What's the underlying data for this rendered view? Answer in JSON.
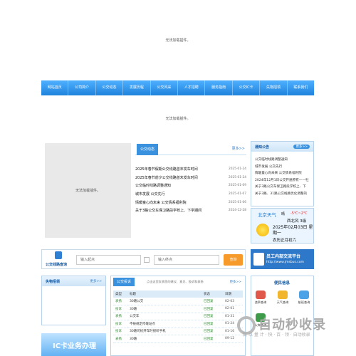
{
  "plugin": {
    "msg": "无法加载插件。"
  },
  "nav": [
    "网站首页",
    "公司简介",
    "公交动态",
    "发展历程",
    "公交风采",
    "人才招聘",
    "服务指南",
    "公交IC卡",
    "失物招领",
    "联系我们"
  ],
  "news": {
    "tab": "公交动态",
    "more": "更多>>",
    "items": [
      {
        "title": "2025年春节假期公交线路首末发车时间",
        "date": "2025-01-24"
      },
      {
        "title": "2025年春节前夕公交线路首末发车时间",
        "date": "2025-01-24"
      },
      {
        "title": "公交临时线路调整通知",
        "date": "2025-01-09"
      },
      {
        "title": "城市发展 公交先行",
        "date": "2025-01-07"
      },
      {
        "title": "情暖童心向未来 公交情系福利院",
        "date": "2025-01-06"
      },
      {
        "title": "关于3路公交车保卫路段学校上、下学期间",
        "date": "2024-12-28"
      }
    ]
  },
  "notice": {
    "title": "通知公告",
    "more": "更多>>",
    "items": [
      "公交临时线路调整通知",
      "城市发展 公交先行",
      "情暖童心向未来 公交情系福利院",
      "2024年12月1日公交开通原有——社",
      "关于3路公交车保卫路段学校上、下",
      "关于3路、31路公交线路优化调整的"
    ]
  },
  "weather": {
    "city": "北京天气",
    "sky": "晴",
    "temp": "-5℃~2℃",
    "wind": "西北风 3级",
    "date": "2025年02月03日 星期一",
    "bottom": "农历正月初六"
  },
  "search": {
    "label": "公交线路查询",
    "from_placeholder": "输入起点",
    "to_placeholder": "输入终点",
    "button": "查询"
  },
  "staff": {
    "title": "员工内部交流平台",
    "url": "http://www.jmsbus.com"
  },
  "lost": {
    "title": "失物招领",
    "more": "更多>>"
  },
  "complaints": {
    "tab": "公交投诉",
    "hint": "点击这里发表您的建议、意见、投诉和表扬",
    "more": "更多>>",
    "headers": [
      "类型",
      "标题",
      "状态",
      "日期"
    ],
    "rows": [
      {
        "type": "表扬",
        "title": "30路公交",
        "status": "已回复",
        "date": "02-03"
      },
      {
        "type": "投诉",
        "title": "30路",
        "status": "已回复",
        "date": "02-01"
      },
      {
        "type": "表扬",
        "title": "公交车",
        "status": "已回复",
        "date": "01-31"
      },
      {
        "type": "投诉",
        "title": "不按规定停靠站点",
        "status": "已回复",
        "date": "01-24"
      },
      {
        "type": "投诉",
        "title": "30路司机开车时接听手机",
        "status": "已回复",
        "date": "01-16"
      },
      {
        "type": "表扬",
        "title": "30路",
        "status": "已回复",
        "date": "09-12"
      }
    ]
  },
  "convenience": {
    "title": "便民信息",
    "items": [
      "违章查询",
      "天气查询",
      "航班查询",
      "火车查询"
    ]
  },
  "ic_banner": "IC卡业务办理",
  "watermark": {
    "title": "自动秒收录",
    "sub": "数 以 量 计 · 快 · 百 · 领 · 自动收录"
  },
  "colors": {
    "nav_top": "#4fb0ff",
    "nav_bottom": "#1f83dc",
    "accent": "#3a92de",
    "search_btn": "#f59a2b"
  }
}
